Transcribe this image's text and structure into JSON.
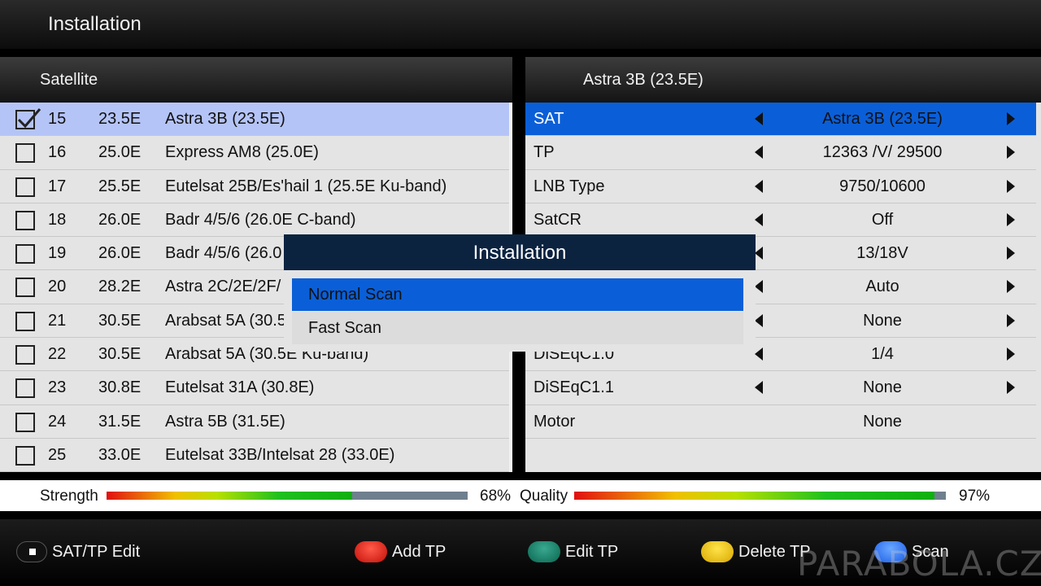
{
  "header": {
    "title": "Installation"
  },
  "satellite_panel": {
    "title": "Satellite",
    "rows": [
      {
        "checked": true,
        "num": "15",
        "pos": "23.5E",
        "name": "Astra 3B (23.5E)",
        "selected": true
      },
      {
        "checked": false,
        "num": "16",
        "pos": "25.0E",
        "name": "Express AM8 (25.0E)"
      },
      {
        "checked": false,
        "num": "17",
        "pos": "25.5E",
        "name": "Eutelsat 25B/Es'hail 1 (25.5E Ku-band)"
      },
      {
        "checked": false,
        "num": "18",
        "pos": "26.0E",
        "name": "Badr 4/5/6 (26.0E C-band)"
      },
      {
        "checked": false,
        "num": "19",
        "pos": "26.0E",
        "name": "Badr 4/5/6 (26.0"
      },
      {
        "checked": false,
        "num": "20",
        "pos": "28.2E",
        "name": "Astra 2C/2E/2F/"
      },
      {
        "checked": false,
        "num": "21",
        "pos": "30.5E",
        "name": "Arabsat 5A (30.5"
      },
      {
        "checked": false,
        "num": "22",
        "pos": "30.5E",
        "name": "Arabsat 5A (30.5E Ku-band)"
      },
      {
        "checked": false,
        "num": "23",
        "pos": "30.8E",
        "name": "Eutelsat 31A (30.8E)"
      },
      {
        "checked": false,
        "num": "24",
        "pos": "31.5E",
        "name": "Astra 5B (31.5E)"
      },
      {
        "checked": false,
        "num": "25",
        "pos": "33.0E",
        "name": "Eutelsat 33B/Intelsat 28 (33.0E)"
      }
    ]
  },
  "settings_panel": {
    "title": "Astra 3B (23.5E)",
    "rows": [
      {
        "label": "SAT",
        "value": "Astra 3B (23.5E)",
        "arrows": true,
        "selected": true
      },
      {
        "label": "TP",
        "value": "12363 /V/ 29500",
        "arrows": true
      },
      {
        "label": "LNB Type",
        "value": "9750/10600",
        "arrows": true
      },
      {
        "label": "SatCR",
        "value": "Off",
        "arrows": true
      },
      {
        "label": "",
        "value": "13/18V",
        "arrows": true
      },
      {
        "label": "",
        "value": "Auto",
        "arrows": true
      },
      {
        "label": "",
        "value": "None",
        "arrows": true
      },
      {
        "label": "DiSEqC1.0",
        "value": "1/4",
        "arrows": true
      },
      {
        "label": "DiSEqC1.1",
        "value": "None",
        "arrows": true
      },
      {
        "label": "Motor",
        "value": "None",
        "arrows": false
      }
    ]
  },
  "signal": {
    "strength_label": "Strength",
    "strength_value": 0.68,
    "strength_text": "68%",
    "quality_label": "Quality",
    "quality_value": 0.97,
    "quality_text": "97%"
  },
  "footer": {
    "buttons": [
      {
        "color": "black",
        "label": "SAT/TP Edit"
      },
      {
        "color": "red",
        "label": "Add TP"
      },
      {
        "color": "green",
        "label": "Edit TP"
      },
      {
        "color": "yellow",
        "label": "Delete TP"
      },
      {
        "color": "blue",
        "label": "Scan"
      }
    ],
    "watermark": "PARABOLA.CZ"
  },
  "dialog": {
    "title": "Installation",
    "options": [
      "Normal Scan",
      "Fast Scan"
    ],
    "selected_index": 0
  }
}
